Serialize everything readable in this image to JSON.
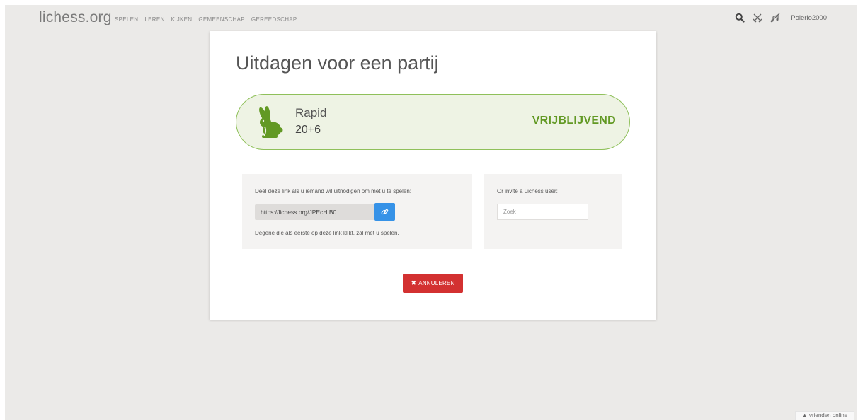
{
  "header": {
    "logo_main": "lichess",
    "logo_tld": ".org",
    "nav": [
      "SPELEN",
      "LEREN",
      "KIJKEN",
      "GEMEENSCHAP",
      "GEREEDSCHAP"
    ],
    "username": "Polerio2000",
    "icons": [
      "search-icon",
      "swords-icon",
      "sound-off-icon"
    ]
  },
  "challenge": {
    "title": "Uitdagen voor een partij",
    "speed": "Rapid",
    "clock": "20+6",
    "mode": "VRIJBLIJVEND",
    "variant_icon": "rabbit-icon"
  },
  "share": {
    "instruction": "Deel deze link als u iemand wil uitnodigen om met u te spelen:",
    "url": "https://lichess.org/JPEcHtB0",
    "note": "Degene die als eerste op deze link klikt, zal met u spelen."
  },
  "invite": {
    "label": "Or invite a Lichess user:",
    "placeholder": "Zoek"
  },
  "cancel_label": "ANNULEREN",
  "friends_label": "vrienden online",
  "colors": {
    "accent_green": "#629924",
    "cancel_red": "#d33131",
    "copy_blue": "#3692e7",
    "background": "#ebeae8"
  }
}
